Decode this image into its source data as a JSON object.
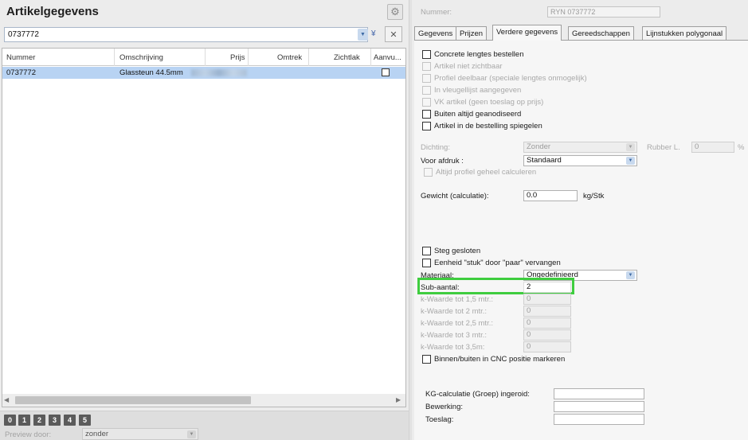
{
  "left": {
    "title": "Artikelgegevens",
    "search": {
      "value": "0737772"
    },
    "columns": [
      "Nummer",
      "Omschrijving",
      "Prijs",
      "Omtrek",
      "Zichtlak",
      "Aanvu..."
    ],
    "rows": [
      {
        "nummer": "0737772",
        "omschrijving": "Glassteun 44.5mm",
        "checked": false
      }
    ],
    "levels": [
      "0",
      "1",
      "2",
      "3",
      "4",
      "5"
    ],
    "preview": {
      "label": "Preview door:",
      "value": "zonder"
    }
  },
  "right": {
    "nummer": {
      "label": "Nummer:",
      "value": "RYN 0737772"
    },
    "tabs": [
      "Gegevens",
      "Prijzen",
      "Verdere gegevens",
      "Gereedschappen",
      "Lijnstukken polygonaal"
    ],
    "active_tab": "Verdere gegevens",
    "checks_top": [
      {
        "label": "Concrete lengtes bestellen",
        "enabled": true,
        "checked": false
      },
      {
        "label": "Artikel niet zichtbaar",
        "enabled": false,
        "checked": false
      },
      {
        "label": "Profiel deelbaar (speciale lengtes onmogelijk)",
        "enabled": false,
        "checked": false
      },
      {
        "label": "In vleugellijst aangegeven",
        "enabled": false,
        "checked": false
      },
      {
        "label": "VK artikel (geen toeslag op prijs)",
        "enabled": false,
        "checked": false
      },
      {
        "label": "Buiten altijd geanodiseerd",
        "enabled": true,
        "checked": false
      },
      {
        "label": "Artikel in de bestelling spiegelen",
        "enabled": true,
        "checked": false
      }
    ],
    "dichting": {
      "label": "Dichting:",
      "value": "Zonder"
    },
    "rubber": {
      "label": "Rubber L.",
      "value": "0",
      "unit": "%"
    },
    "afdruk": {
      "label": "Voor afdruk :",
      "value": "Standaard"
    },
    "altijd_profiel": {
      "label": "Altijd profiel geheel calculeren"
    },
    "gewicht": {
      "label": "Gewicht (calculatie):",
      "value": "0.0",
      "unit": "kg/Stk"
    },
    "checks_mid": [
      {
        "label": "Steg gesloten",
        "enabled": true,
        "checked": false
      },
      {
        "label": "Eenheid \"stuk\" door \"paar\" vervangen",
        "enabled": true,
        "checked": false
      }
    ],
    "materiaal": {
      "label": "Materiaal:",
      "value": "Ongedefinieerd"
    },
    "sub_aantal": {
      "label": "Sub-aantal:",
      "value": "2"
    },
    "kwaardes": [
      {
        "label": "k-Waarde tot 1,5 mtr.:",
        "value": "0"
      },
      {
        "label": "k-Waarde tot 2 mtr.:",
        "value": "0"
      },
      {
        "label": "k-Waarde tot 2,5 mtr.:",
        "value": "0"
      },
      {
        "label": "k-Waarde tot 3 mtr.:",
        "value": "0"
      },
      {
        "label": "k-Waarde tot 3,5m:",
        "value": "0"
      }
    ],
    "cnc": {
      "label": "Binnen/buiten in CNC positie markeren"
    },
    "kg_calc": {
      "label": "KG-calculatie (Groep) ingeroid:",
      "value": ""
    },
    "bewerking": {
      "label": "Bewerking:",
      "value": ""
    },
    "toeslag": {
      "label": "Toeslag:",
      "value": ""
    }
  },
  "colors": {
    "selected_row": "#b8d3f3",
    "highlight": "#3fcd3f"
  }
}
